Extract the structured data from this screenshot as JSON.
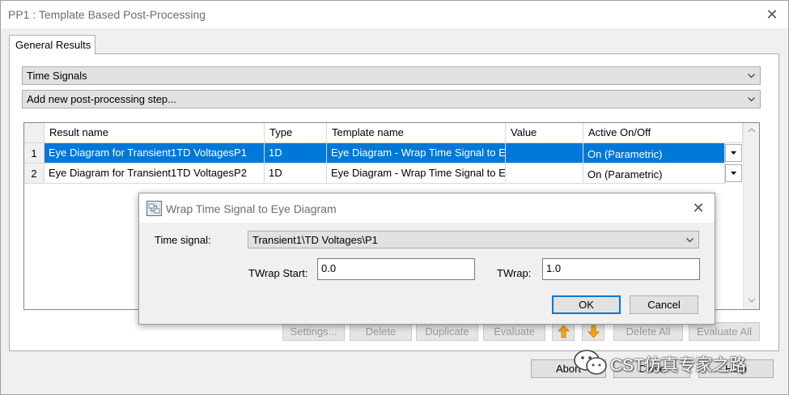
{
  "window": {
    "title": "PP1 : Template Based Post-Processing"
  },
  "tabs": [
    {
      "label": "General Results",
      "active": true
    }
  ],
  "result_type_combo": {
    "value": "Time Signals"
  },
  "step_combo": {
    "value": "Add new post-processing step..."
  },
  "table": {
    "columns": [
      "Result name",
      "Type",
      "Template name",
      "Value",
      "Active On/Off"
    ],
    "rows": [
      {
        "num": "1",
        "result_name": "Eye Diagram for Transient1TD VoltagesP1",
        "type": "1D",
        "template_name": "Eye Diagram - Wrap Time Signal to Eye Diagram",
        "value": "",
        "active": "On (Parametric)",
        "selected": true
      },
      {
        "num": "2",
        "result_name": "Eye Diagram for Transient1TD VoltagesP2",
        "type": "1D",
        "template_name": "Eye Diagram - Wrap Time Signal to Eye Diagram",
        "value": "",
        "active": "On (Parametric)",
        "selected": false
      }
    ]
  },
  "action_buttons": {
    "settings": "Settings...",
    "delete": "Delete",
    "duplicate": "Duplicate",
    "evaluate": "Evaluate",
    "move_up_icon": "arrow-up-icon",
    "move_down_icon": "arrow-down-icon",
    "delete_all": "Delete All",
    "evaluate_all": "Evaluate All"
  },
  "bottom_buttons": {
    "abort": "Abort",
    "close": "Close",
    "help": "Help"
  },
  "wrap_dialog": {
    "title": "Wrap Time Signal to Eye Diagram",
    "time_signal_label": "Time signal:",
    "time_signal_value": "Transient1\\TD Voltages\\P1",
    "twrap_start_label": "TWrap Start:",
    "twrap_start_value": "0.0",
    "twrap_label": "TWrap:",
    "twrap_value": "1.0",
    "ok_label": "OK",
    "cancel_label": "Cancel"
  },
  "watermark": {
    "text": "CST仿真专家之路",
    "icon": "wechat-icon"
  },
  "colors": {
    "selection": "#0078d7",
    "disabled_text": "#9a9a9a",
    "arrow_orange": "#f5a623"
  }
}
